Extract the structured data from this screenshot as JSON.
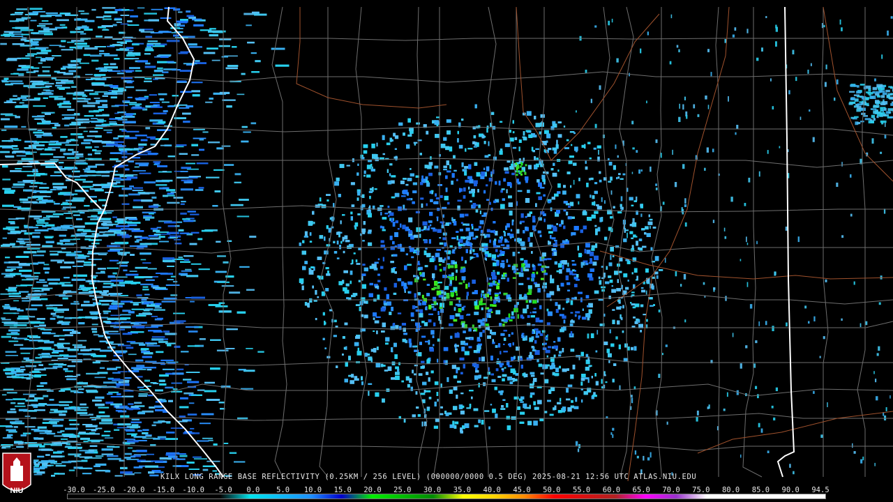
{
  "product": {
    "caption": "KILX LONG RANGE BASE REFLECTIVITY (0.25KM / 256 LEVEL) (000000/0000 0.5 DEG) 2025-08-21 12:56 UTC  ATLAS.NIU.EDU"
  },
  "logo": {
    "text": "NIU"
  },
  "colorscale": {
    "labels": [
      "-30.0",
      "-25.0",
      "-20.0",
      "-15.0",
      "-10.0",
      "-5.0",
      "0.0",
      "5.0",
      "10.0",
      "15.0",
      "20.0",
      "25.0",
      "30.0",
      "35.0",
      "40.0",
      "45.0",
      "50.0",
      "55.0",
      "60.0",
      "65.0",
      "70.0",
      "75.0",
      "80.0",
      "85.0",
      "90.0",
      "94.5"
    ],
    "stops": [
      {
        "v": -30,
        "color": "#000000"
      },
      {
        "v": -5,
        "color": "#000000"
      },
      {
        "v": 0,
        "color": "#00e5ee"
      },
      {
        "v": 10,
        "color": "#1e90ff"
      },
      {
        "v": 15,
        "color": "#0000cd"
      },
      {
        "v": 20,
        "color": "#00ee00"
      },
      {
        "v": 30,
        "color": "#008b00"
      },
      {
        "v": 35,
        "color": "#ffff00"
      },
      {
        "v": 40,
        "color": "#ffd700"
      },
      {
        "v": 45,
        "color": "#ff8c00"
      },
      {
        "v": 50,
        "color": "#ff0000"
      },
      {
        "v": 60,
        "color": "#b22222"
      },
      {
        "v": 65,
        "color": "#ff00ff"
      },
      {
        "v": 70,
        "color": "#9932cc"
      },
      {
        "v": 75,
        "color": "#ffffff"
      },
      {
        "v": 94.5,
        "color": "#ffffff"
      }
    ]
  },
  "colors": {
    "background": "#000000",
    "county_lines": "#6e6e6e",
    "state_lines": "#ffffff",
    "rivers": "#a0522d",
    "echo_light": "#40c8f0",
    "echo_mid": "#1e78ff",
    "echo_strong": "#22dd22"
  }
}
